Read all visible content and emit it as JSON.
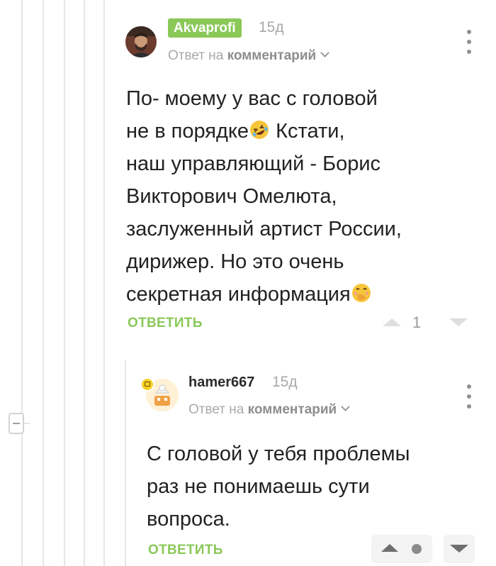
{
  "comment1": {
    "author": "Akvaprofi",
    "time": "15д",
    "reply_prefix": "Ответ на",
    "reply_link": "комментарий",
    "text_lines": [
      "По- моему у вас с головой",
      "не в порядке",
      " Кстати,",
      "наш управляющий - Борис",
      "Викторович Омелюта,",
      "заслуженный артист России,",
      "дирижер. Но это очень",
      "секретная информация"
    ],
    "reply_label": "ОТВЕТИТЬ",
    "rating": "1"
  },
  "comment2": {
    "author": "hamer667",
    "time": "15д",
    "reply_prefix": "Ответ на",
    "reply_link": "комментарий",
    "text_lines": [
      "С головой у тебя проблемы",
      "раз не понимаешь сути",
      "вопроса."
    ],
    "reply_label": "ОТВЕТИТЬ"
  },
  "icons": {
    "laughing_emoji": "rolling-on-floor-laughing",
    "hand_over_mouth_emoji": "face-with-hand-over-mouth"
  },
  "colors": {
    "accent": "#8ac858",
    "muted": "#a9a9a9"
  }
}
